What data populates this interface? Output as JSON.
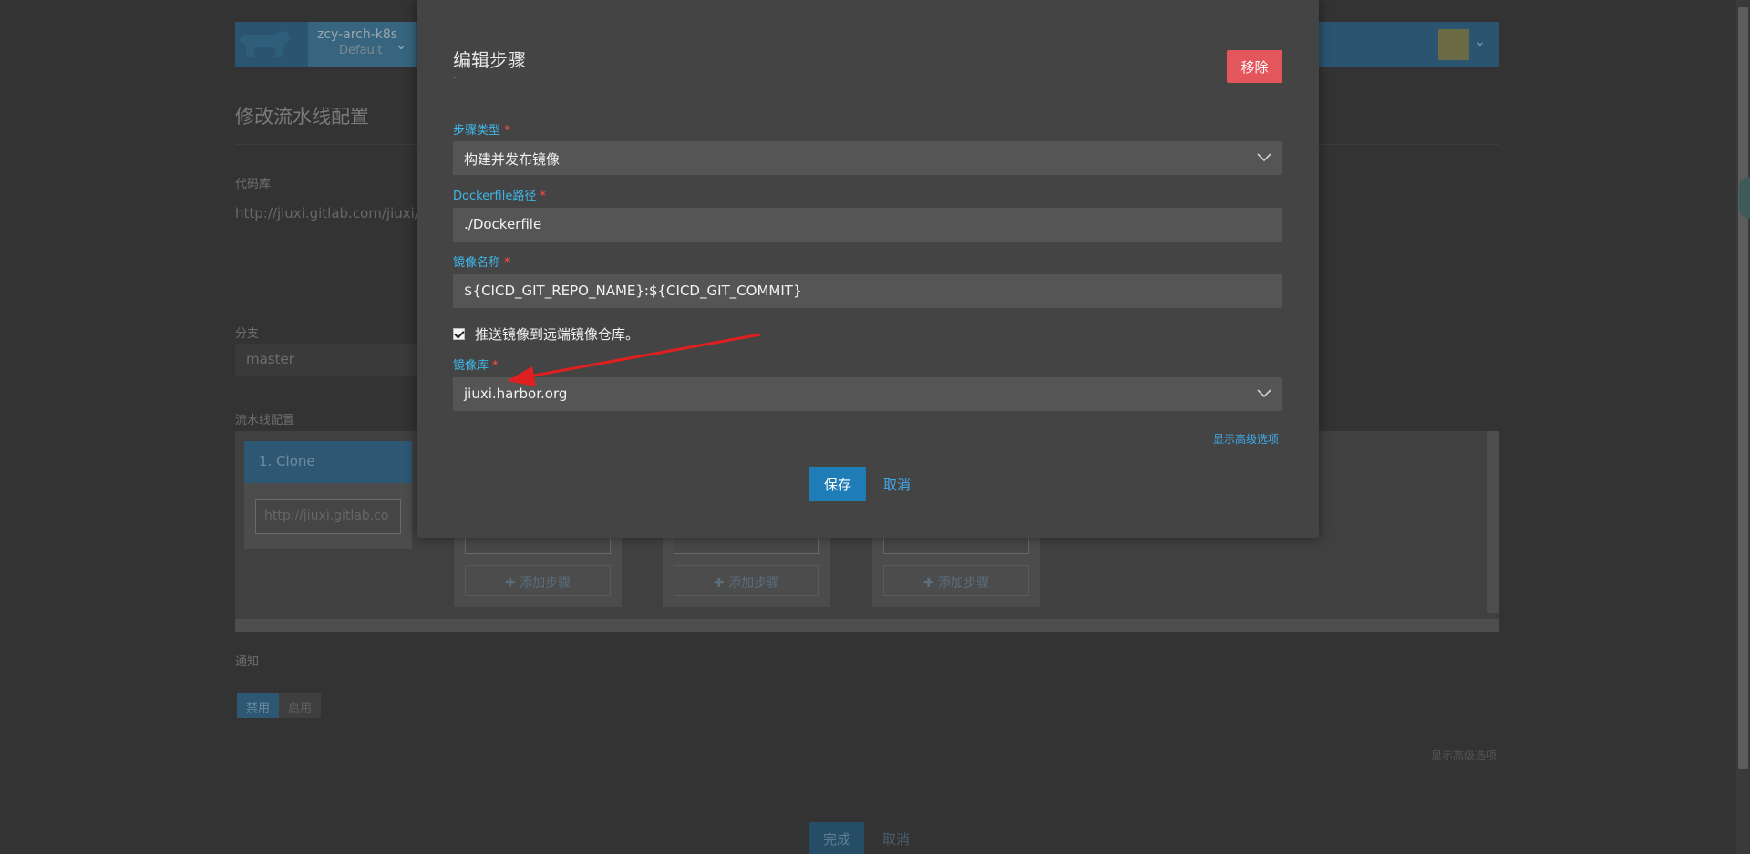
{
  "header": {
    "cluster_name": "zcy-arch-k8s",
    "project_name": "Default"
  },
  "page": {
    "title": "修改流水线配置",
    "repo_label": "代码库",
    "repo_url": "http://jiuxi.gitlab.com/jiuxi/c",
    "branch_label": "分支",
    "branch_value": "master",
    "pipeline_label": "流水线配置",
    "stage1_title": "1. Clone",
    "stage1_url": "http://jiuxi.gitlab.co",
    "add_step_label": "添加步骤",
    "notify_label": "通知",
    "notify_options": [
      "禁用",
      "启用"
    ],
    "advanced_link": "显示高级选项",
    "done_label": "完成",
    "cancel_label": "取消"
  },
  "modal": {
    "title": "编辑步骤",
    "subtitle": "-",
    "remove_label": "移除",
    "step_type": {
      "label": "步骤类型",
      "value": "构建并发布镜像"
    },
    "dockerfile": {
      "label": "Dockerfile路径",
      "value": "./Dockerfile"
    },
    "image_name": {
      "label": "镜像名称",
      "value": "${CICD_GIT_REPO_NAME}:${CICD_GIT_COMMIT}"
    },
    "push_checkbox": {
      "label": "推送镜像到远端镜像仓库。",
      "checked": true
    },
    "registry": {
      "label": "镜像库",
      "value": "jiuxi.harbor.org"
    },
    "advanced_link": "显示高级选项",
    "save_label": "保存",
    "cancel_label": "取消"
  },
  "colors": {
    "accent": "#3fb6e8",
    "danger": "#e3565b",
    "primary": "#1e7db6",
    "annotation_arrow": "#e02020"
  }
}
